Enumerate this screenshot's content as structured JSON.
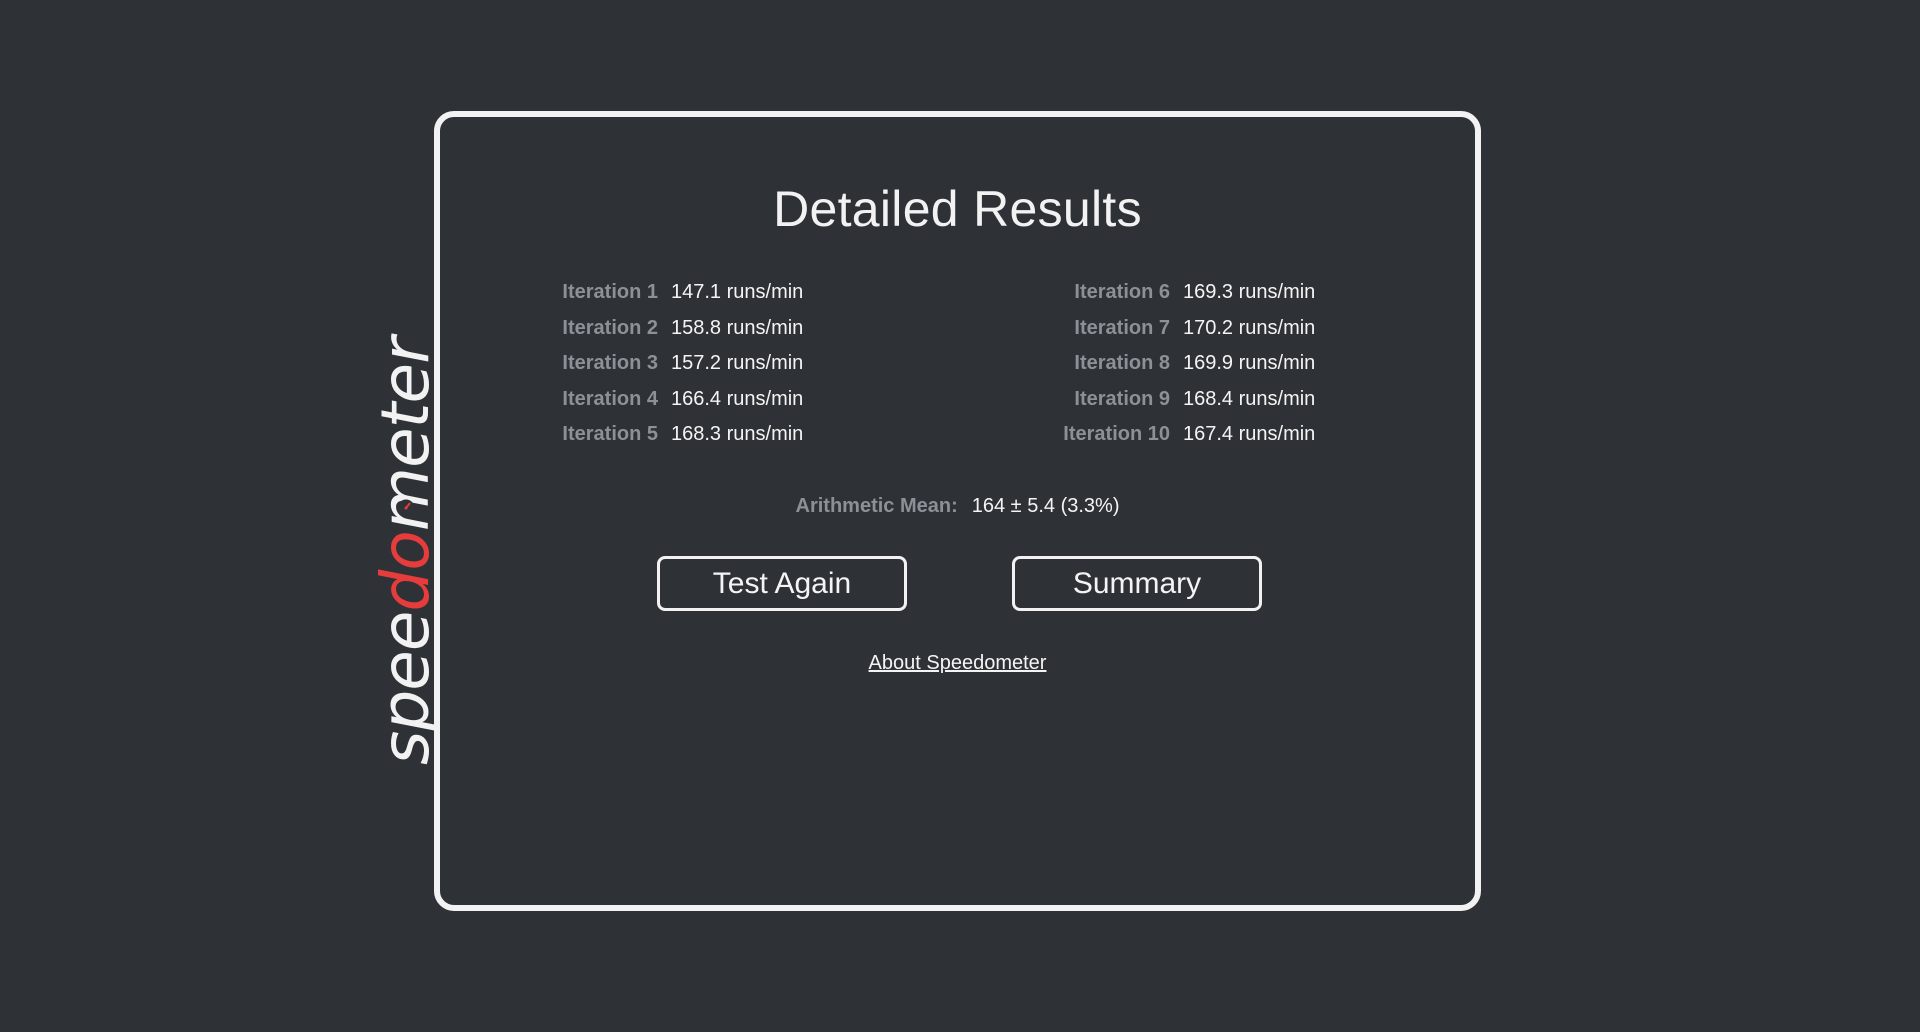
{
  "logo": {
    "part1": "spee",
    "part2": "do",
    "part3": "meter",
    "accent_color": "#e63c3c",
    "text_color": "#f2f2f2"
  },
  "results": {
    "title": "Detailed Results",
    "iterations_left": [
      {
        "label": "Iteration 1",
        "value": "147.1 runs/min"
      },
      {
        "label": "Iteration 2",
        "value": "158.8 runs/min"
      },
      {
        "label": "Iteration 3",
        "value": "157.2 runs/min"
      },
      {
        "label": "Iteration 4",
        "value": "166.4 runs/min"
      },
      {
        "label": "Iteration 5",
        "value": "168.3 runs/min"
      }
    ],
    "iterations_right": [
      {
        "label": "Iteration 6",
        "value": "169.3 runs/min"
      },
      {
        "label": "Iteration 7",
        "value": "170.2 runs/min"
      },
      {
        "label": "Iteration 8",
        "value": "169.9 runs/min"
      },
      {
        "label": "Iteration 9",
        "value": "168.4 runs/min"
      },
      {
        "label": "Iteration 10",
        "value": "167.4 runs/min"
      }
    ],
    "mean_label": "Arithmetic Mean:",
    "mean_value": "164 ± 5.4 (3.3%)"
  },
  "buttons": {
    "test_again": "Test Again",
    "summary": "Summary"
  },
  "footer": {
    "about_link": "About Speedometer"
  }
}
